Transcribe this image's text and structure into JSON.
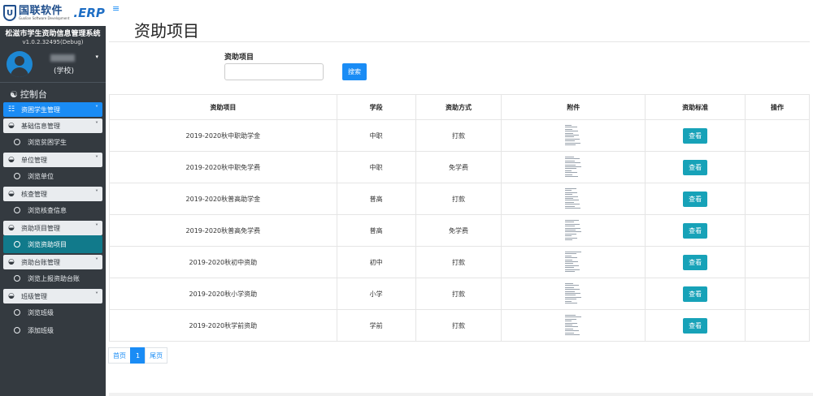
{
  "brand": {
    "logo_cn": "国联软件",
    "logo_en": "Guolian Software Development",
    "logo_suffix": ".ERP",
    "system_title": "松滋市学生资助信息管理系统",
    "version": "v1.0.2.32495(Debug)"
  },
  "user": {
    "role": "(学校)",
    "caret": "▾"
  },
  "sidebar": {
    "console_label": "控制台",
    "menu": [
      {
        "type": "group",
        "label": "资困学生管理",
        "icon": "grid-icon",
        "active": true
      },
      {
        "type": "group",
        "label": "基础信息管理",
        "icon": "dashboard-icon"
      },
      {
        "type": "sub",
        "label": "浏览贫困学生"
      },
      {
        "type": "group",
        "label": "单位管理",
        "icon": "dashboard-icon"
      },
      {
        "type": "sub",
        "label": "浏览单位"
      },
      {
        "type": "group",
        "label": "核查管理",
        "icon": "dashboard-icon"
      },
      {
        "type": "sub",
        "label": "浏览核查信息"
      },
      {
        "type": "group",
        "label": "资助项目管理",
        "icon": "dashboard-icon"
      },
      {
        "type": "sub",
        "label": "浏览资助项目",
        "active": true
      },
      {
        "type": "group",
        "label": "资助台账管理",
        "icon": "dashboard-icon"
      },
      {
        "type": "sub",
        "label": "浏览上报资助台账"
      },
      {
        "type": "group",
        "label": "班级管理",
        "icon": "dashboard-icon"
      },
      {
        "type": "sub",
        "label": "浏览班级"
      },
      {
        "type": "sub",
        "label": "添加班级"
      }
    ]
  },
  "page": {
    "title": "资助项目"
  },
  "search": {
    "label": "资助项目",
    "value": "",
    "placeholder": "",
    "button_label": "搜索"
  },
  "table": {
    "headers": [
      "资助项目",
      "学段",
      "资助方式",
      "附件",
      "资助标准",
      "操作"
    ],
    "view_label": "查看",
    "rows": [
      {
        "name": "2019-2020秋中职助学金",
        "stage": "中职",
        "method": "打款"
      },
      {
        "name": "2019-2020秋中职免学费",
        "stage": "中职",
        "method": "免学费"
      },
      {
        "name": "2019-2020秋普高助学金",
        "stage": "普高",
        "method": "打款"
      },
      {
        "name": "2019-2020秋普高免学费",
        "stage": "普高",
        "method": "免学费"
      },
      {
        "name": "2019-2020秋初中资助",
        "stage": "初中",
        "method": "打款"
      },
      {
        "name": "2019-2020秋小学资助",
        "stage": "小学",
        "method": "打款"
      },
      {
        "name": "2019-2020秋学前资助",
        "stage": "学前",
        "method": "打款"
      }
    ]
  },
  "pagination": {
    "first": "首页",
    "current": "1",
    "last": "尾页"
  },
  "colors": {
    "sidebar_bg": "#343a40",
    "primary": "#1a8cf5",
    "info": "#17a2b8",
    "active_sub": "#117a8b"
  }
}
